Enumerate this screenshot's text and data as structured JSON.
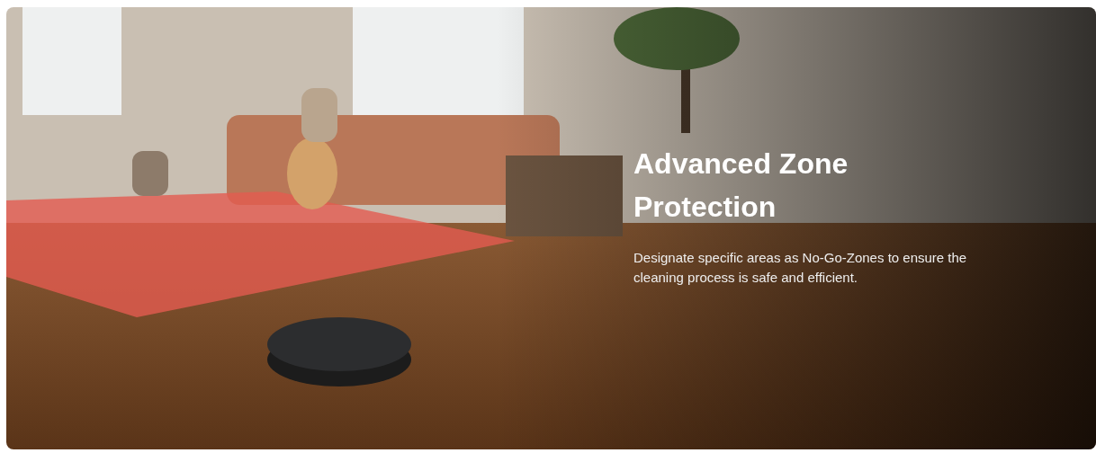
{
  "banner": {
    "title": "Advanced Zone Protection",
    "description": "Designate specific areas as No-Go-Zones to ensure the cleaning process is safe and efficient."
  }
}
